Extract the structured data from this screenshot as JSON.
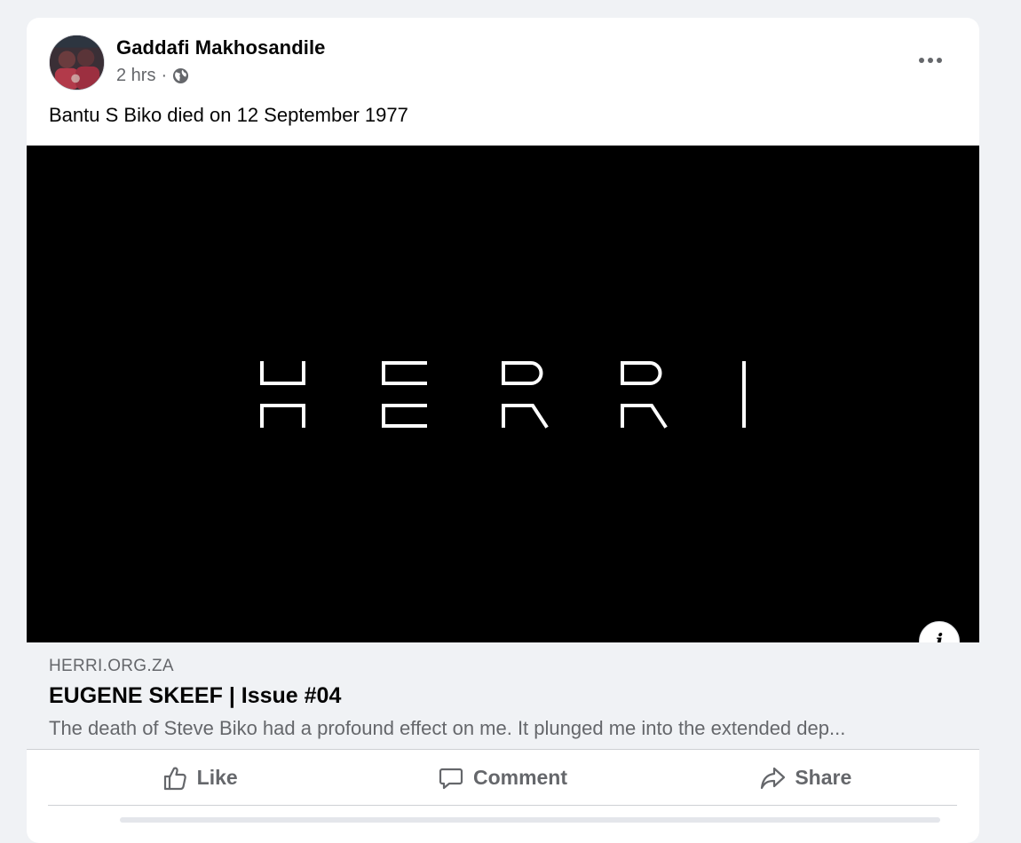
{
  "post": {
    "author": "Gaddafi Makhosandile",
    "timestamp": "2 hrs",
    "separator": "·",
    "audience_icon": "globe-icon",
    "text": "Bantu S Biko died on 12 September 1977",
    "more_icon": "more-options-icon"
  },
  "media": {
    "logo_text": "HERRI",
    "background": "#000000",
    "info_label": "i"
  },
  "link_preview": {
    "domain": "HERRI.ORG.ZA",
    "title": "EUGENE SKEEF | Issue #04",
    "description": "The death of Steve Biko had a profound effect on me. It plunged me into the extended dep..."
  },
  "actions": {
    "like": "Like",
    "comment": "Comment",
    "share": "Share"
  },
  "colors": {
    "background": "#f0f2f5",
    "card": "#ffffff",
    "secondary_text": "#65676b",
    "primary_text": "#050505"
  }
}
